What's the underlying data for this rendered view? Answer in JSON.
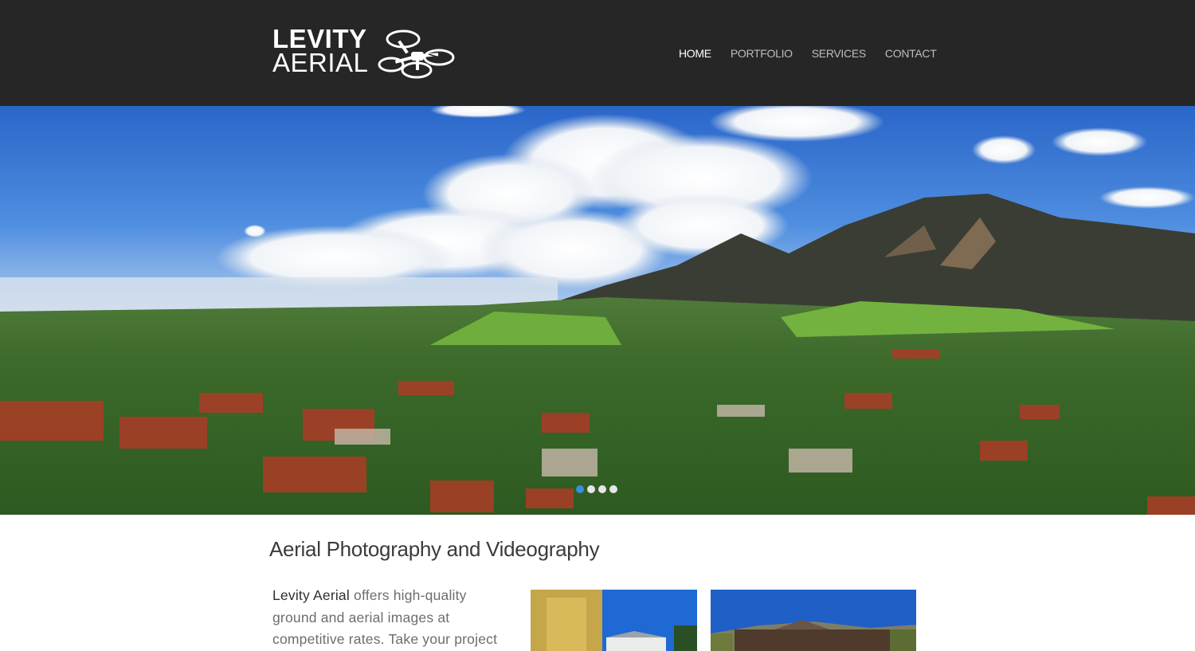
{
  "brand": {
    "line1": "LEVITY",
    "line2": "AERIAL"
  },
  "nav": {
    "items": [
      {
        "label": "HOME",
        "active": true
      },
      {
        "label": "PORTFOLIO",
        "active": false
      },
      {
        "label": "SERVICES",
        "active": false
      },
      {
        "label": "CONTACT",
        "active": false
      }
    ]
  },
  "hero": {
    "slide_count": 4,
    "active_slide": 1
  },
  "main": {
    "title": "Aerial Photography and Videography",
    "intro_brand": "Levity Aerial",
    "intro_lines": [
      " offers high-quality",
      "ground and aerial images at",
      "competitive rates. Take your project"
    ]
  },
  "colors": {
    "header_bg": "#262626",
    "nav_active": "#ffffff",
    "nav_inactive": "#bdbdbd",
    "slider_active": "#3a8dde"
  }
}
